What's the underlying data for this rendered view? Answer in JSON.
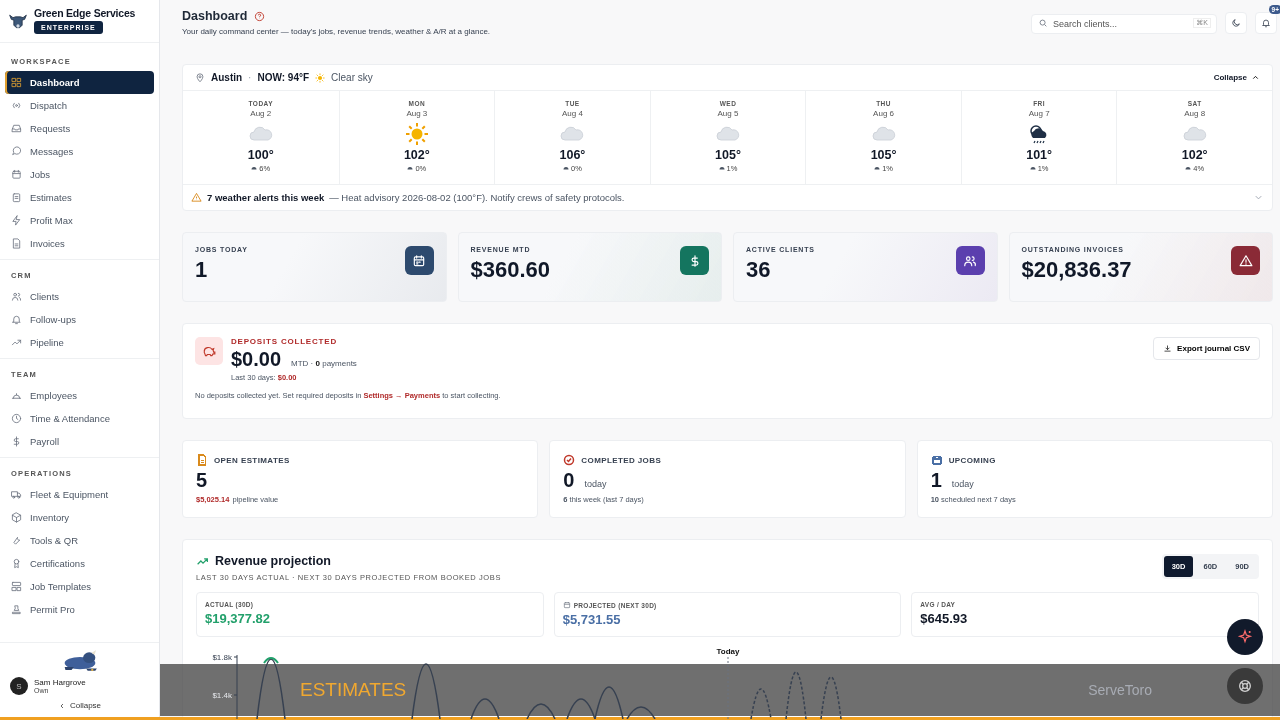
{
  "sidebar": {
    "company": "Green Edge Services",
    "plan": "ENTERPRISE",
    "sections": [
      {
        "title": "WORKSPACE",
        "items": [
          {
            "label": "Dashboard",
            "selected": true
          },
          {
            "label": "Dispatch",
            "selected": false
          },
          {
            "label": "Requests",
            "selected": false
          },
          {
            "label": "Messages",
            "selected": false
          },
          {
            "label": "Jobs",
            "selected": false
          },
          {
            "label": "Estimates",
            "selected": false
          },
          {
            "label": "Profit Max",
            "selected": false
          },
          {
            "label": "Invoices",
            "selected": false
          }
        ]
      },
      {
        "title": "CRM",
        "items": [
          {
            "label": "Clients",
            "selected": false
          },
          {
            "label": "Follow-ups",
            "selected": false
          },
          {
            "label": "Pipeline",
            "selected": false
          }
        ]
      },
      {
        "title": "TEAM",
        "items": [
          {
            "label": "Employees",
            "selected": false
          },
          {
            "label": "Time & Attendance",
            "selected": false
          },
          {
            "label": "Payroll",
            "selected": false
          }
        ]
      },
      {
        "title": "OPERATIONS",
        "items": [
          {
            "label": "Fleet & Equipment",
            "selected": false
          },
          {
            "label": "Inventory",
            "selected": false
          },
          {
            "label": "Tools & QR",
            "selected": false
          },
          {
            "label": "Certifications",
            "selected": false
          },
          {
            "label": "Job Templates",
            "selected": false
          },
          {
            "label": "Permit Pro",
            "selected": false
          }
        ]
      }
    ],
    "user": {
      "name": "Sam Hargrove",
      "role": "Own",
      "avatar": "S"
    },
    "collapse": "Collapse"
  },
  "header": {
    "title": "Dashboard",
    "subtitle": "Your daily command center — today's jobs, revenue trends, weather & A/R at a glance.",
    "search_placeholder": "Search clients...",
    "shortcut": "⌘K",
    "notification_badge": "9+"
  },
  "weather": {
    "city": "Austin",
    "separator": "·",
    "now": "NOW: 94°F",
    "sky": "Clear sky",
    "collapse": "Collapse",
    "days": [
      {
        "day": "TODAY",
        "date": "Aug 2",
        "kind": "cloud",
        "temp": "100°",
        "precip": "6%"
      },
      {
        "day": "MON",
        "date": "Aug 3",
        "kind": "sun",
        "temp": "102°",
        "precip": "0%"
      },
      {
        "day": "TUE",
        "date": "Aug 4",
        "kind": "cloud",
        "temp": "106°",
        "precip": "0%"
      },
      {
        "day": "WED",
        "date": "Aug 5",
        "kind": "cloud",
        "temp": "105°",
        "precip": "1%"
      },
      {
        "day": "THU",
        "date": "Aug 6",
        "kind": "cloud",
        "temp": "105°",
        "precip": "1%"
      },
      {
        "day": "FRI",
        "date": "Aug 7",
        "kind": "storm",
        "temp": "101°",
        "precip": "1%"
      },
      {
        "day": "SAT",
        "date": "Aug 8",
        "kind": "cloud",
        "temp": "102°",
        "precip": "4%"
      }
    ],
    "alert_title": "7 weather alerts this week",
    "alert_text": "— Heat advisory 2026-08-02 (100°F). Notify crews of safety protocols."
  },
  "stats": [
    {
      "label": "JOBS TODAY",
      "value": "1",
      "color": "#2d4a6e"
    },
    {
      "label": "REVENUE MTD",
      "value": "$360.60",
      "color": "#14755f"
    },
    {
      "label": "ACTIVE CLIENTS",
      "value": "36",
      "color": "#5b3fae"
    },
    {
      "label": "OUTSTANDING INVOICES",
      "value": "$20,836.37",
      "color": "#8a2a36"
    }
  ],
  "deposits": {
    "title": "DEPOSITS COLLECTED",
    "amount": "$0.00",
    "detail": "MTD · **0** payments",
    "last30_label": "Last 30 days:",
    "last30_value": "$0.00",
    "export": "Export journal CSV",
    "note_before": "No deposits collected yet. Set required deposits in",
    "note_link": "Settings → Payments",
    "note_after": "to start collecting."
  },
  "summary": [
    {
      "label": "OPEN ESTIMATES",
      "value": "5",
      "highlight": "$5,025.14",
      "note": "pipeline value",
      "color": "#d98a1c"
    },
    {
      "label": "COMPLETED JOBS",
      "value": "0",
      "unit": "today",
      "note": "**6** this week (last 7 days)",
      "color": "#c0392b"
    },
    {
      "label": "UPCOMING",
      "value": "1",
      "unit": "today",
      "note": "**10** scheduled next 7 days",
      "color": "#4a6fa5"
    }
  ],
  "revenue": {
    "title": "Revenue projection",
    "subtitle": "LAST 30 DAYS ACTUAL · NEXT 30 DAYS PROJECTED FROM BOOKED JOBS",
    "ranges": [
      {
        "label": "30D",
        "selected": true
      },
      {
        "label": "60D",
        "selected": false
      },
      {
        "label": "90D",
        "selected": false
      }
    ],
    "metrics": [
      {
        "label": "ACTUAL (30D)",
        "value": "$19,377.82",
        "color": "#22a06b"
      },
      {
        "label": "PROJECTED (NEXT 30D)",
        "value": "$5,731.55",
        "color": "#4a6fa5"
      },
      {
        "label": "AVG / DAY",
        "value": "$645.93",
        "color": "#111827"
      }
    ],
    "y_ticks": [
      "$1.8k",
      "$1.4k"
    ],
    "today_label": "Today"
  },
  "caption": {
    "title": "ESTIMATES",
    "brand": "ServeToro"
  }
}
